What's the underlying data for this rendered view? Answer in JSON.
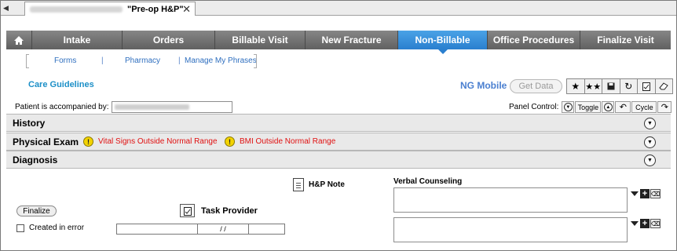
{
  "document_tab": {
    "name": "\"Pre-op H&P\"",
    "close_glyph": "✕",
    "scroll_glyph": "◀"
  },
  "nav": {
    "home_icon": "home-icon",
    "items": [
      "Intake",
      "Orders",
      "Billable Visit",
      "New Fracture",
      "Non-Billable",
      "Office Procedures",
      "Finalize Visit"
    ],
    "active": "Non-Billable",
    "active_color": "#2a7fcf"
  },
  "submenu": {
    "forms": "Forms",
    "pharmacy": "Pharmacy",
    "manage_phrases": "Manage My Phrases",
    "separator": "|"
  },
  "care_guidelines": "Care Guidelines",
  "ng_mobile": "NG Mobile",
  "get_data": "Get Data",
  "toolbar_icons": [
    "star-icon",
    "double-star-icon",
    "save-icon",
    "refresh-icon",
    "checklist-icon",
    "eraser-icon"
  ],
  "accompanied_label": "Patient is accompanied by:",
  "panel_control": {
    "label": "Panel Control:",
    "toggle": "Toggle",
    "cycle": "Cycle"
  },
  "sections": {
    "history": "History",
    "physical_exam": "Physical Exam",
    "diagnosis": "Diagnosis",
    "warnings": [
      "Vital Signs Outside Normal Range",
      "BMI Outside Normal Range"
    ],
    "warning_color": "#e01010"
  },
  "form": {
    "hp_note": "H&P Note",
    "finalize": "Finalize",
    "task_provider": "Task Provider",
    "created_in_error": "Created in error",
    "date_placeholder": "/ /",
    "verbal_counseling": "Verbal Counseling"
  }
}
